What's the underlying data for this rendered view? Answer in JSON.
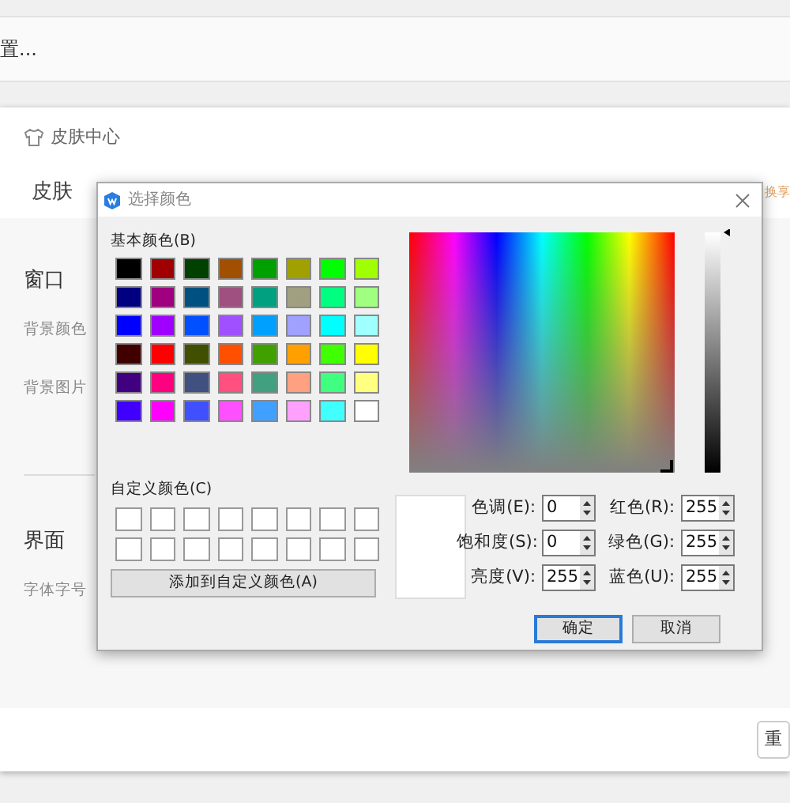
{
  "top_row": {
    "text": "置..."
  },
  "skin_center": {
    "title": "皮肤中心",
    "tabs": [
      {
        "label": "皮肤",
        "selected": true
      }
    ],
    "right_link": "换享",
    "sections": [
      {
        "heading": "窗口",
        "items": [
          "背景颜色",
          "背景图片"
        ]
      },
      {
        "heading": "界面",
        "items": [
          "字体字号"
        ]
      }
    ],
    "footer_button": "重"
  },
  "dialog": {
    "title": "选择颜色",
    "basic_label": "基本颜色(B)",
    "basic_colors": [
      {
        "color": "#000000"
      },
      {
        "color": "#a00000"
      },
      {
        "color": "#004000"
      },
      {
        "color": "#a05000"
      },
      {
        "color": "#00a000"
      },
      {
        "color": "#a0a000"
      },
      {
        "color": "#00ff00"
      },
      {
        "color": "#a0ff00"
      },
      {
        "color": "#000080"
      },
      {
        "color": "#a00080"
      },
      {
        "color": "#005080"
      },
      {
        "color": "#a05080"
      },
      {
        "color": "#00a080"
      },
      {
        "color": "#a0a080"
      },
      {
        "color": "#00ff80"
      },
      {
        "color": "#a0ff80"
      },
      {
        "color": "#0000ff"
      },
      {
        "color": "#a000ff"
      },
      {
        "color": "#0050ff"
      },
      {
        "color": "#a050ff"
      },
      {
        "color": "#00a0ff"
      },
      {
        "color": "#a0a0ff"
      },
      {
        "color": "#00ffff"
      },
      {
        "color": "#a0ffff"
      },
      {
        "color": "#400000"
      },
      {
        "color": "#ff0000"
      },
      {
        "color": "#405000"
      },
      {
        "color": "#ff5000"
      },
      {
        "color": "#40a000"
      },
      {
        "color": "#ffa000"
      },
      {
        "color": "#40ff00"
      },
      {
        "color": "#ffff00"
      },
      {
        "color": "#400080"
      },
      {
        "color": "#ff0080"
      },
      {
        "color": "#405080"
      },
      {
        "color": "#ff5080"
      },
      {
        "color": "#40a080"
      },
      {
        "color": "#ffa080"
      },
      {
        "color": "#40ff80"
      },
      {
        "color": "#ffff80"
      },
      {
        "color": "#4000ff"
      },
      {
        "color": "#ff00ff"
      },
      {
        "color": "#4050ff"
      },
      {
        "color": "#ff50ff"
      },
      {
        "color": "#40a0ff"
      },
      {
        "color": "#ffa0ff"
      },
      {
        "color": "#40ffff"
      },
      {
        "color": "#ffffff"
      }
    ],
    "custom_label": "自定义颜色(C)",
    "custom_colors": [
      {
        "color": "#ffffff"
      },
      {
        "color": "#ffffff"
      },
      {
        "color": "#ffffff"
      },
      {
        "color": "#ffffff"
      },
      {
        "color": "#ffffff"
      },
      {
        "color": "#ffffff"
      },
      {
        "color": "#ffffff"
      },
      {
        "color": "#ffffff"
      },
      {
        "color": "#ffffff"
      },
      {
        "color": "#ffffff"
      },
      {
        "color": "#ffffff"
      },
      {
        "color": "#ffffff"
      },
      {
        "color": "#ffffff"
      },
      {
        "color": "#ffffff"
      },
      {
        "color": "#ffffff"
      },
      {
        "color": "#ffffff"
      }
    ],
    "add_button": "添加到自定义颜色(A)",
    "luminance": {
      "level": 1
    },
    "fields": [
      {
        "label": "色调(E):",
        "value": "0"
      },
      {
        "label": "红色(R):",
        "value": "255"
      },
      {
        "label": "饱和度(S):",
        "value": "0"
      },
      {
        "label": "绿色(G):",
        "value": "255"
      },
      {
        "label": "亮度(V):",
        "value": "255"
      },
      {
        "label": "蓝色(U):",
        "value": "255"
      }
    ],
    "buttons": [
      {
        "label": "确定",
        "default": true
      },
      {
        "label": "取消",
        "default": false
      }
    ]
  }
}
